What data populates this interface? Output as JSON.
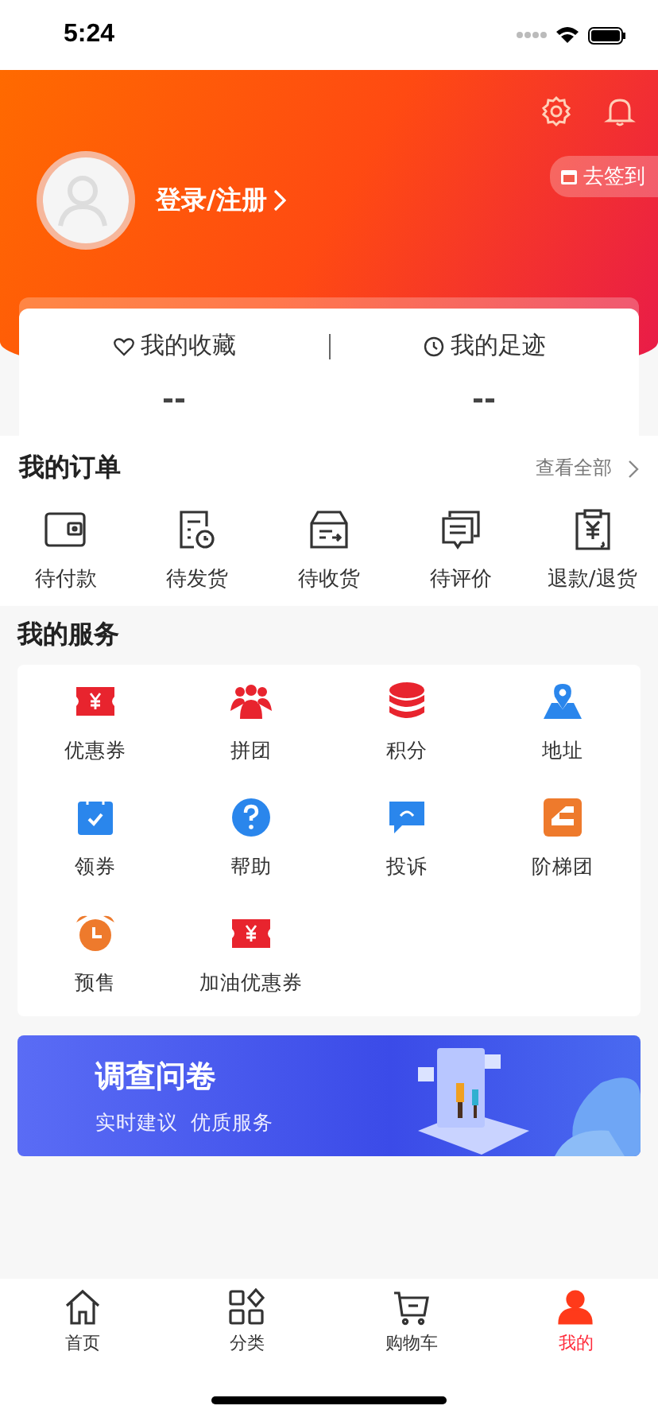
{
  "status_bar": {
    "time": "5:24"
  },
  "profile": {
    "login_text": "登录/注册",
    "checkin": "去签到"
  },
  "stats": [
    {
      "kind": "favorites",
      "label": "我的收藏",
      "value": "--"
    },
    {
      "kind": "history",
      "label": "我的足迹",
      "value": "--"
    }
  ],
  "orders": {
    "title": "我的订单",
    "view_all": "查看全部",
    "items": [
      {
        "kind": "wallet",
        "label": "待付款"
      },
      {
        "kind": "doc-clock",
        "label": "待发货"
      },
      {
        "kind": "box",
        "label": "待收货"
      },
      {
        "kind": "chat",
        "label": "待评价"
      },
      {
        "kind": "refund",
        "label": "退款/退货"
      }
    ]
  },
  "services": {
    "title": "我的服务",
    "items": [
      {
        "kind": "ticket",
        "label": "优惠券",
        "color": "#e8242e"
      },
      {
        "kind": "group",
        "label": "拼团",
        "color": "#e8242e"
      },
      {
        "kind": "coins",
        "label": "积分",
        "color": "#e8242e"
      },
      {
        "kind": "pin",
        "label": "地址",
        "color": "#2a86ec"
      },
      {
        "kind": "calendar",
        "label": "领券",
        "color": "#2a86ec"
      },
      {
        "kind": "help",
        "label": "帮助",
        "color": "#2a86ec"
      },
      {
        "kind": "bubble",
        "label": "投诉",
        "color": "#2a86ec"
      },
      {
        "kind": "stairs",
        "label": "阶梯团",
        "color": "#ee7a2c"
      },
      {
        "kind": "alarm",
        "label": "预售",
        "color": "#ee7a2c"
      },
      {
        "kind": "ticket",
        "label": "加油优惠券",
        "color": "#e8242e"
      }
    ]
  },
  "banner": {
    "title": "调查问卷",
    "subtitle": "实时建议  优质服务"
  },
  "tabs": [
    {
      "kind": "home",
      "label": "首页",
      "selected": false
    },
    {
      "kind": "category",
      "label": "分类",
      "selected": false
    },
    {
      "kind": "cart",
      "label": "购物车",
      "selected": false
    },
    {
      "kind": "me",
      "label": "我的",
      "selected": true
    }
  ]
}
